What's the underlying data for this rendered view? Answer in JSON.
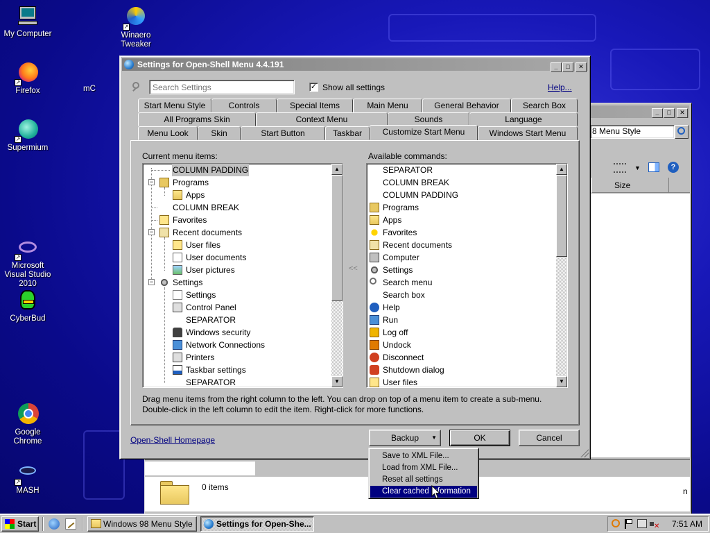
{
  "desktop": {
    "icons": [
      {
        "label": "My Computer",
        "icon": "my-computer-icon"
      },
      {
        "label": "Winaero Tweaker",
        "icon": "winaero-icon"
      },
      {
        "label": "Firefox",
        "icon": "firefox-icon"
      },
      {
        "label": "Supermium",
        "icon": "supermium-icon"
      },
      {
        "label": "Microsoft Visual Studio 2010",
        "icon": "visual-studio-icon"
      },
      {
        "label": "CyberBud",
        "icon": "cyberbud-icon"
      },
      {
        "label": "Google Chrome",
        "icon": "chrome-icon"
      },
      {
        "label": "MASH",
        "icon": "mash-icon"
      },
      {
        "label": "mC",
        "icon": "partial-icon"
      }
    ]
  },
  "bg_window": {
    "search_value": "8 Menu Style",
    "col_size": "Size",
    "status": "0 items",
    "edge_glyph": "n"
  },
  "dialog": {
    "title": "Settings for Open-Shell Menu 4.4.191",
    "search_placeholder": "Search Settings",
    "show_all_label": "Show all settings",
    "show_all_checked": true,
    "help_link": "Help...",
    "tabs_row1": [
      "Start Menu Style",
      "Controls",
      "Special Items",
      "Main Menu",
      "General Behavior",
      "Search Box"
    ],
    "tabs_row2": [
      "All Programs Skin",
      "Context Menu",
      "Sounds",
      "Language"
    ],
    "tabs_row3": [
      "Menu Look",
      "Skin",
      "Start Button",
      "Taskbar",
      "Customize Start Menu",
      "Windows Start Menu"
    ],
    "active_tab": "Customize Start Menu",
    "current_label": "Current menu items:",
    "available_label": "Available commands:",
    "move_glyph": "<<",
    "current_items": [
      {
        "text": "COLUMN PADDING",
        "icon": "",
        "selected": true
      },
      {
        "text": "Programs",
        "icon": "programs-icon"
      },
      {
        "text": "Apps",
        "icon": "apps-icon"
      },
      {
        "text": "COLUMN BREAK",
        "icon": ""
      },
      {
        "text": "Favorites",
        "icon": "favorites-icon"
      },
      {
        "text": "Recent documents",
        "icon": "recent-documents-icon"
      },
      {
        "text": "User files",
        "icon": "user-files-icon"
      },
      {
        "text": "User documents",
        "icon": "user-documents-icon"
      },
      {
        "text": "User pictures",
        "icon": "user-pictures-icon"
      },
      {
        "text": "Settings",
        "icon": "settings-icon"
      },
      {
        "text": "Settings",
        "icon": "settings-page-icon"
      },
      {
        "text": "Control Panel",
        "icon": "control-panel-icon"
      },
      {
        "text": "SEPARATOR",
        "icon": ""
      },
      {
        "text": "Windows security",
        "icon": "windows-security-icon"
      },
      {
        "text": "Network Connections",
        "icon": "network-connections-icon"
      },
      {
        "text": "Printers",
        "icon": "printers-icon"
      },
      {
        "text": "Taskbar settings",
        "icon": "taskbar-settings-icon"
      },
      {
        "text": "SEPARATOR",
        "icon": ""
      }
    ],
    "available_items": [
      {
        "text": "SEPARATOR",
        "icon": ""
      },
      {
        "text": "COLUMN BREAK",
        "icon": ""
      },
      {
        "text": "COLUMN PADDING",
        "icon": ""
      },
      {
        "text": "Programs",
        "icon": "programs-icon"
      },
      {
        "text": "Apps",
        "icon": "apps-icon"
      },
      {
        "text": "Favorites",
        "icon": "favorites-star-icon"
      },
      {
        "text": "Recent documents",
        "icon": "recent-documents-icon"
      },
      {
        "text": "Computer",
        "icon": "computer-icon"
      },
      {
        "text": "Settings",
        "icon": "settings-icon"
      },
      {
        "text": "Search menu",
        "icon": "search-icon"
      },
      {
        "text": "Search box",
        "icon": ""
      },
      {
        "text": "Help",
        "icon": "help-icon"
      },
      {
        "text": "Run",
        "icon": "run-icon"
      },
      {
        "text": "Log off",
        "icon": "log-off-icon"
      },
      {
        "text": "Undock",
        "icon": "undock-icon"
      },
      {
        "text": "Disconnect",
        "icon": "disconnect-icon"
      },
      {
        "text": "Shutdown dialog",
        "icon": "shutdown-icon"
      },
      {
        "text": "User files",
        "icon": "user-files-icon"
      }
    ],
    "hint_line1": "Drag menu items from the right column to the left. You can drop on top of a menu item to create a sub-menu.",
    "hint_line2": "Double-click in the left column to edit the item. Right-click for more functions.",
    "homepage_link": "Open-Shell Homepage",
    "backup_label": "Backup",
    "ok_label": "OK",
    "cancel_label": "Cancel"
  },
  "backup_menu": {
    "items": [
      "Save to XML File...",
      "Load from XML File...",
      "Reset all settings",
      "Clear cached information"
    ],
    "highlighted": "Clear cached information"
  },
  "taskbar": {
    "start_label": "Start",
    "tasks": [
      {
        "label": "Windows 98 Menu Style",
        "pressed": false
      },
      {
        "label": "Settings for Open-She...",
        "pressed": true
      }
    ],
    "clock": "7:51 AM"
  },
  "colors": {
    "selection": "#000080",
    "title_inactive": "#808080",
    "link": "#000080"
  }
}
